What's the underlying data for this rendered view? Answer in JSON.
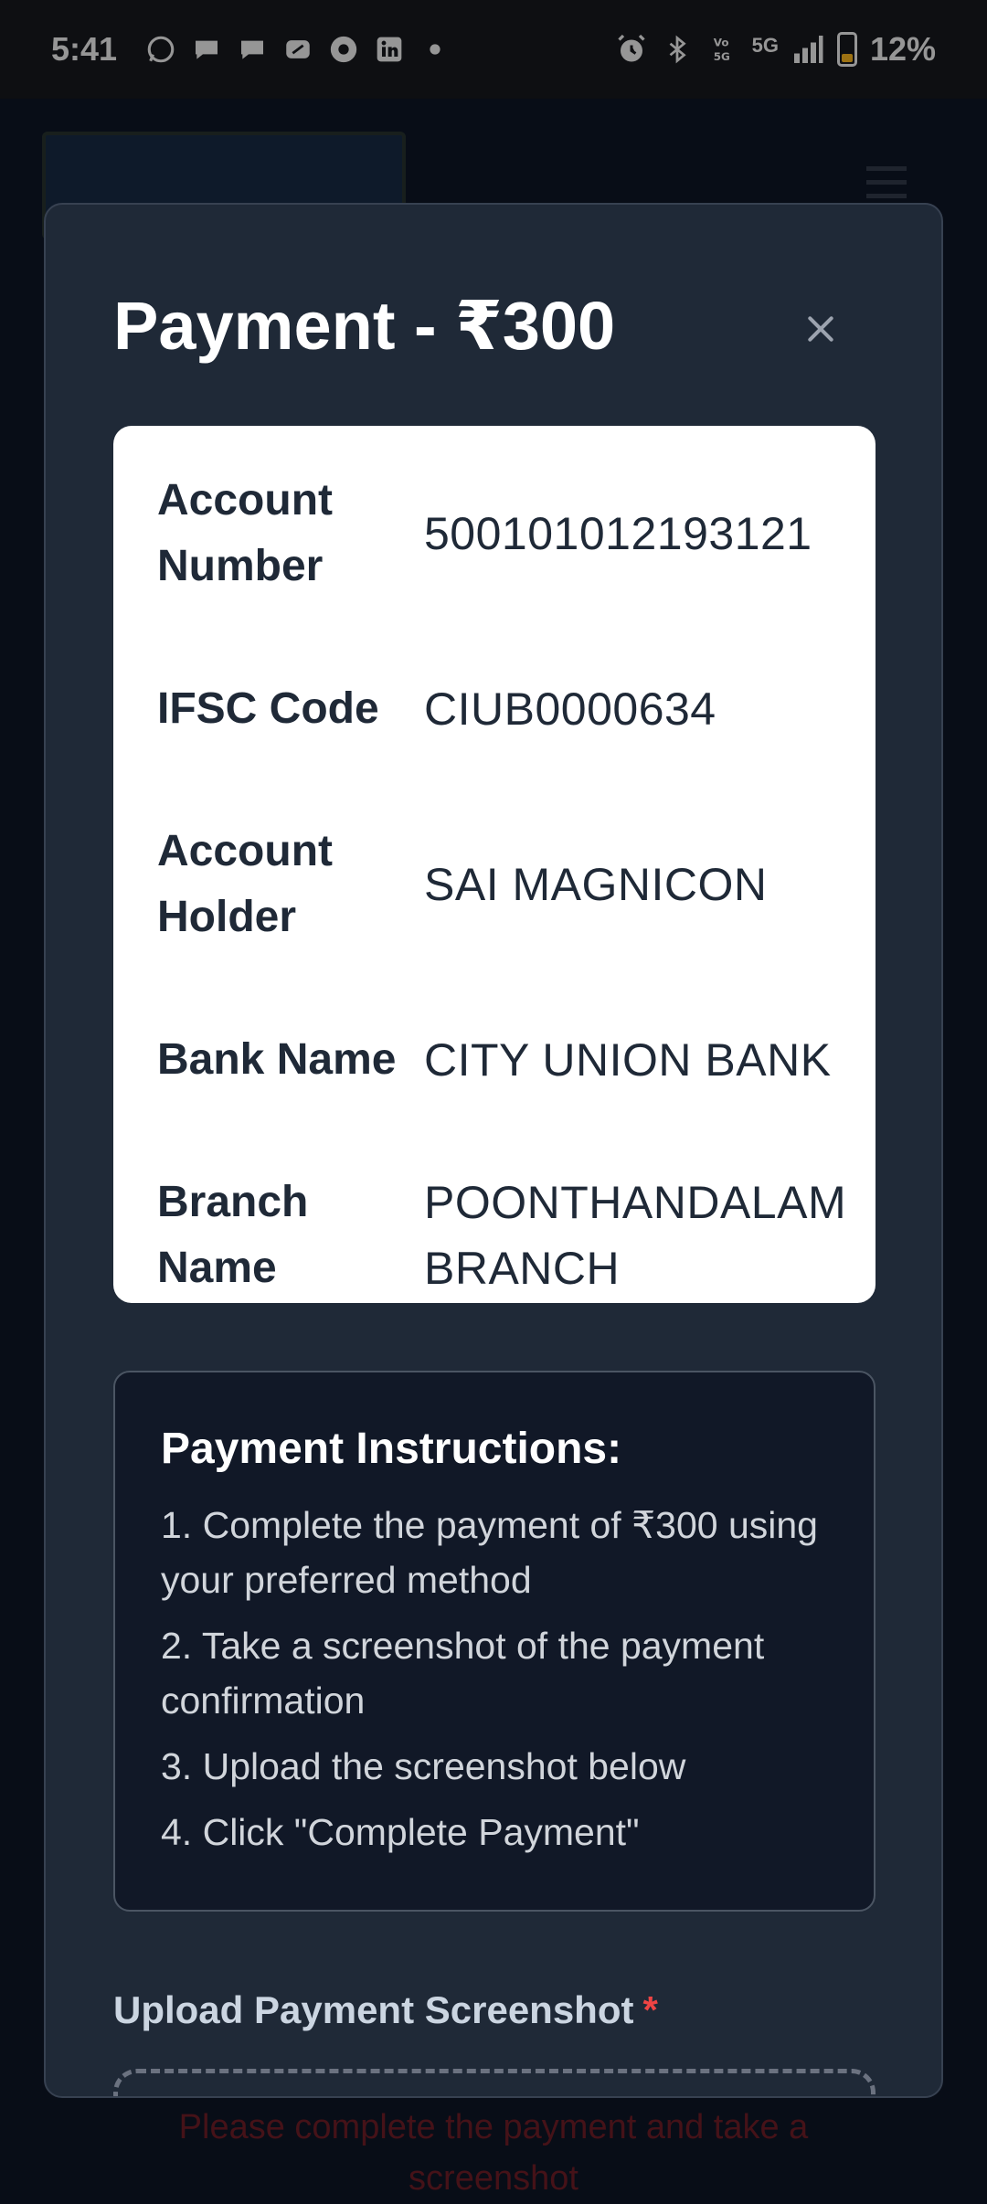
{
  "status_bar": {
    "time": "5:41",
    "network": "5G",
    "battery": "12%",
    "icons": [
      "whatsapp-icon",
      "chat-icon",
      "chat-icon",
      "app-icon",
      "chrome-icon",
      "linkedin-icon",
      "dot-icon",
      "alarm-icon",
      "bluetooth-icon",
      "volte-icon",
      "signal-icon",
      "battery-icon"
    ]
  },
  "modal": {
    "title": "Payment - ₹300",
    "close_symbol": "×"
  },
  "account_details": [
    {
      "label": "Account Number",
      "value": "500101012193121"
    },
    {
      "label": "IFSC Code",
      "value": "CIUB0000634"
    },
    {
      "label": "Account Holder",
      "value": "SAI MAGNICON"
    },
    {
      "label": "Bank Name",
      "value": "CITY UNION BANK"
    },
    {
      "label": "Branch Name",
      "value": "POONTHANDALAM BRANCH"
    }
  ],
  "instructions": {
    "title": "Payment Instructions:",
    "items": [
      "1. Complete the payment of ₹300 using your preferred method",
      "2. Take a screenshot of the payment confirmation",
      "3. Upload the screenshot below",
      "4. Click \"Complete Payment\""
    ]
  },
  "upload": {
    "label": "Upload Payment Screenshot",
    "required_marker": "*"
  },
  "background": {
    "error_text": "Please complete the payment and take a screenshot"
  },
  "colors": {
    "modal_bg": "#1f2937",
    "card_bg": "#ffffff",
    "instructions_bg": "#111827",
    "required": "#ef4444"
  }
}
